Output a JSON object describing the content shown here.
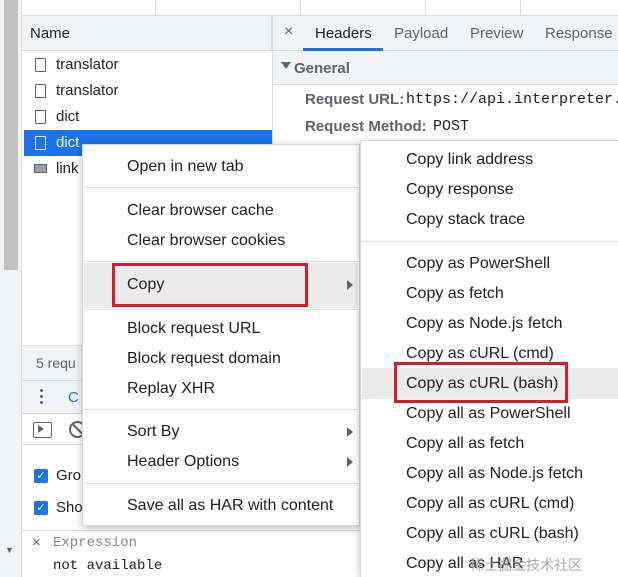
{
  "network_list": {
    "header": "Name",
    "requests": [
      {
        "name": "translator",
        "icon": "document-icon"
      },
      {
        "name": "translator",
        "icon": "document-icon"
      },
      {
        "name": "dict",
        "icon": "document-icon"
      },
      {
        "name": "dict",
        "icon": "document-icon",
        "selected": true
      },
      {
        "name": "link",
        "icon": "image-icon"
      }
    ],
    "status_text": "5 requ"
  },
  "drawer": {
    "tab_partial": "C",
    "checkbox_labels": [
      "Gro",
      "Sho"
    ],
    "expression_close": "×",
    "expression_label": "Expression",
    "expression_value": "not available"
  },
  "details": {
    "close_label": "×",
    "tabs": [
      "Headers",
      "Payload",
      "Preview",
      "Response"
    ],
    "active_tab": "Headers",
    "section_title": "General",
    "headers": [
      {
        "key": "Request URL:",
        "value": "https://api.interpreter.ca"
      },
      {
        "key": "Request Method:",
        "value": "POST"
      }
    ]
  },
  "context_menu": {
    "groups": [
      [
        "Open in new tab"
      ],
      [
        "Clear browser cache",
        "Clear browser cookies"
      ],
      [
        "Copy"
      ],
      [
        "Block request URL",
        "Block request domain",
        "Replay XHR"
      ],
      [
        "Sort By",
        "Header Options"
      ],
      [
        "Save all as HAR with content"
      ]
    ],
    "highlighted": "Copy"
  },
  "copy_submenu": {
    "groups": [
      [
        "Copy link address",
        "Copy response",
        "Copy stack trace"
      ],
      [
        "Copy as PowerShell",
        "Copy as fetch",
        "Copy as Node.js fetch",
        "Copy as cURL (cmd)",
        "Copy as cURL (bash)",
        "Copy all as PowerShell",
        "Copy all as fetch",
        "Copy all as Node.js fetch",
        "Copy all as cURL (cmd)",
        "Copy all as cURL (bash)",
        "Copy all as HAR"
      ]
    ],
    "highlighted": "Copy as cURL (bash)"
  },
  "watermark": "稀土掘金技术社区",
  "colors": {
    "selection_blue": "#1a73e8",
    "annotation_red": "#d11f2a",
    "hover_gray": "#ebebeb"
  }
}
